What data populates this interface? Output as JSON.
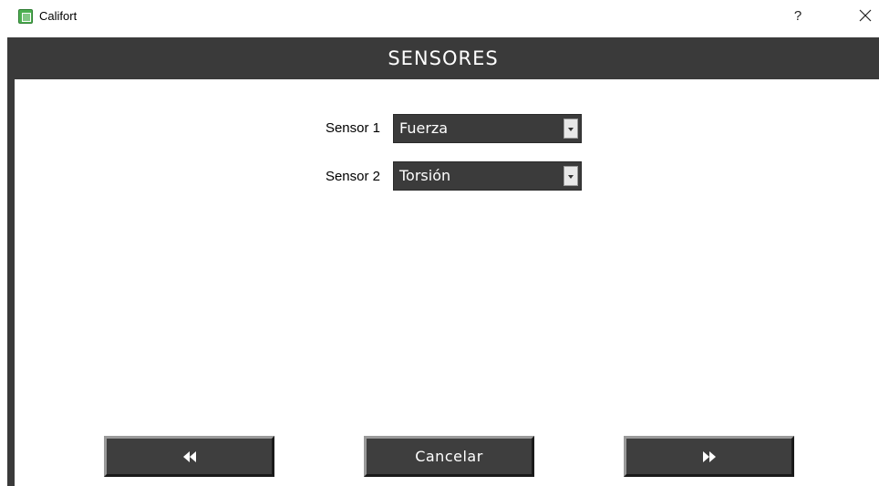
{
  "window": {
    "title": "Califort",
    "help_label": "?"
  },
  "header": {
    "title": "SENSORES"
  },
  "sensors": [
    {
      "label": "Sensor 1",
      "value": "Fuerza"
    },
    {
      "label": "Sensor 2",
      "value": "Torsión"
    }
  ],
  "buttons": {
    "back_icon": "rewind-icon",
    "cancel_label": "Cancelar",
    "next_icon": "fast-forward-icon"
  },
  "colors": {
    "header_bg": "#3a3a3a",
    "button_bg": "#3e3e3e",
    "select_bg": "#3b3b3b"
  }
}
